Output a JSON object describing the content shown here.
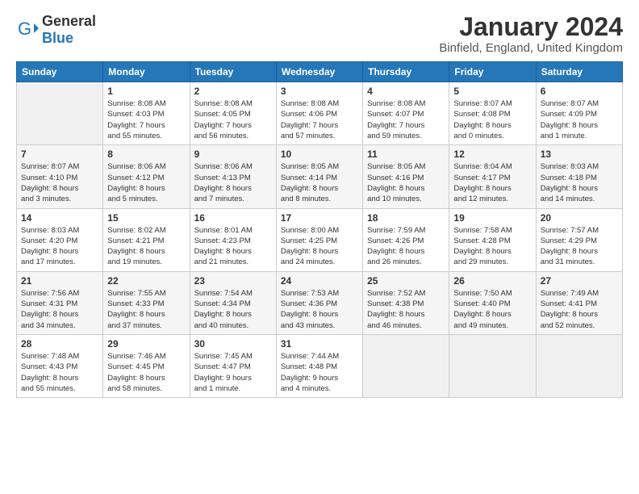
{
  "logo": {
    "general": "General",
    "blue": "Blue"
  },
  "header": {
    "title": "January 2024",
    "subtitle": "Binfield, England, United Kingdom"
  },
  "weekdays": [
    "Sunday",
    "Monday",
    "Tuesday",
    "Wednesday",
    "Thursday",
    "Friday",
    "Saturday"
  ],
  "weeks": [
    [
      {
        "day": "",
        "info": ""
      },
      {
        "day": "1",
        "info": "Sunrise: 8:08 AM\nSunset: 4:03 PM\nDaylight: 7 hours\nand 55 minutes."
      },
      {
        "day": "2",
        "info": "Sunrise: 8:08 AM\nSunset: 4:05 PM\nDaylight: 7 hours\nand 56 minutes."
      },
      {
        "day": "3",
        "info": "Sunrise: 8:08 AM\nSunset: 4:06 PM\nDaylight: 7 hours\nand 57 minutes."
      },
      {
        "day": "4",
        "info": "Sunrise: 8:08 AM\nSunset: 4:07 PM\nDaylight: 7 hours\nand 59 minutes."
      },
      {
        "day": "5",
        "info": "Sunrise: 8:07 AM\nSunset: 4:08 PM\nDaylight: 8 hours\nand 0 minutes."
      },
      {
        "day": "6",
        "info": "Sunrise: 8:07 AM\nSunset: 4:09 PM\nDaylight: 8 hours\nand 1 minute."
      }
    ],
    [
      {
        "day": "7",
        "info": "Sunrise: 8:07 AM\nSunset: 4:10 PM\nDaylight: 8 hours\nand 3 minutes."
      },
      {
        "day": "8",
        "info": "Sunrise: 8:06 AM\nSunset: 4:12 PM\nDaylight: 8 hours\nand 5 minutes."
      },
      {
        "day": "9",
        "info": "Sunrise: 8:06 AM\nSunset: 4:13 PM\nDaylight: 8 hours\nand 7 minutes."
      },
      {
        "day": "10",
        "info": "Sunrise: 8:05 AM\nSunset: 4:14 PM\nDaylight: 8 hours\nand 8 minutes."
      },
      {
        "day": "11",
        "info": "Sunrise: 8:05 AM\nSunset: 4:16 PM\nDaylight: 8 hours\nand 10 minutes."
      },
      {
        "day": "12",
        "info": "Sunrise: 8:04 AM\nSunset: 4:17 PM\nDaylight: 8 hours\nand 12 minutes."
      },
      {
        "day": "13",
        "info": "Sunrise: 8:03 AM\nSunset: 4:18 PM\nDaylight: 8 hours\nand 14 minutes."
      }
    ],
    [
      {
        "day": "14",
        "info": "Sunrise: 8:03 AM\nSunset: 4:20 PM\nDaylight: 8 hours\nand 17 minutes."
      },
      {
        "day": "15",
        "info": "Sunrise: 8:02 AM\nSunset: 4:21 PM\nDaylight: 8 hours\nand 19 minutes."
      },
      {
        "day": "16",
        "info": "Sunrise: 8:01 AM\nSunset: 4:23 PM\nDaylight: 8 hours\nand 21 minutes."
      },
      {
        "day": "17",
        "info": "Sunrise: 8:00 AM\nSunset: 4:25 PM\nDaylight: 8 hours\nand 24 minutes."
      },
      {
        "day": "18",
        "info": "Sunrise: 7:59 AM\nSunset: 4:26 PM\nDaylight: 8 hours\nand 26 minutes."
      },
      {
        "day": "19",
        "info": "Sunrise: 7:58 AM\nSunset: 4:28 PM\nDaylight: 8 hours\nand 29 minutes."
      },
      {
        "day": "20",
        "info": "Sunrise: 7:57 AM\nSunset: 4:29 PM\nDaylight: 8 hours\nand 31 minutes."
      }
    ],
    [
      {
        "day": "21",
        "info": "Sunrise: 7:56 AM\nSunset: 4:31 PM\nDaylight: 8 hours\nand 34 minutes."
      },
      {
        "day": "22",
        "info": "Sunrise: 7:55 AM\nSunset: 4:33 PM\nDaylight: 8 hours\nand 37 minutes."
      },
      {
        "day": "23",
        "info": "Sunrise: 7:54 AM\nSunset: 4:34 PM\nDaylight: 8 hours\nand 40 minutes."
      },
      {
        "day": "24",
        "info": "Sunrise: 7:53 AM\nSunset: 4:36 PM\nDaylight: 8 hours\nand 43 minutes."
      },
      {
        "day": "25",
        "info": "Sunrise: 7:52 AM\nSunset: 4:38 PM\nDaylight: 8 hours\nand 46 minutes."
      },
      {
        "day": "26",
        "info": "Sunrise: 7:50 AM\nSunset: 4:40 PM\nDaylight: 8 hours\nand 49 minutes."
      },
      {
        "day": "27",
        "info": "Sunrise: 7:49 AM\nSunset: 4:41 PM\nDaylight: 8 hours\nand 52 minutes."
      }
    ],
    [
      {
        "day": "28",
        "info": "Sunrise: 7:48 AM\nSunset: 4:43 PM\nDaylight: 8 hours\nand 55 minutes."
      },
      {
        "day": "29",
        "info": "Sunrise: 7:46 AM\nSunset: 4:45 PM\nDaylight: 8 hours\nand 58 minutes."
      },
      {
        "day": "30",
        "info": "Sunrise: 7:45 AM\nSunset: 4:47 PM\nDaylight: 9 hours\nand 1 minute."
      },
      {
        "day": "31",
        "info": "Sunrise: 7:44 AM\nSunset: 4:48 PM\nDaylight: 9 hours\nand 4 minutes."
      },
      {
        "day": "",
        "info": ""
      },
      {
        "day": "",
        "info": ""
      },
      {
        "day": "",
        "info": ""
      }
    ]
  ]
}
